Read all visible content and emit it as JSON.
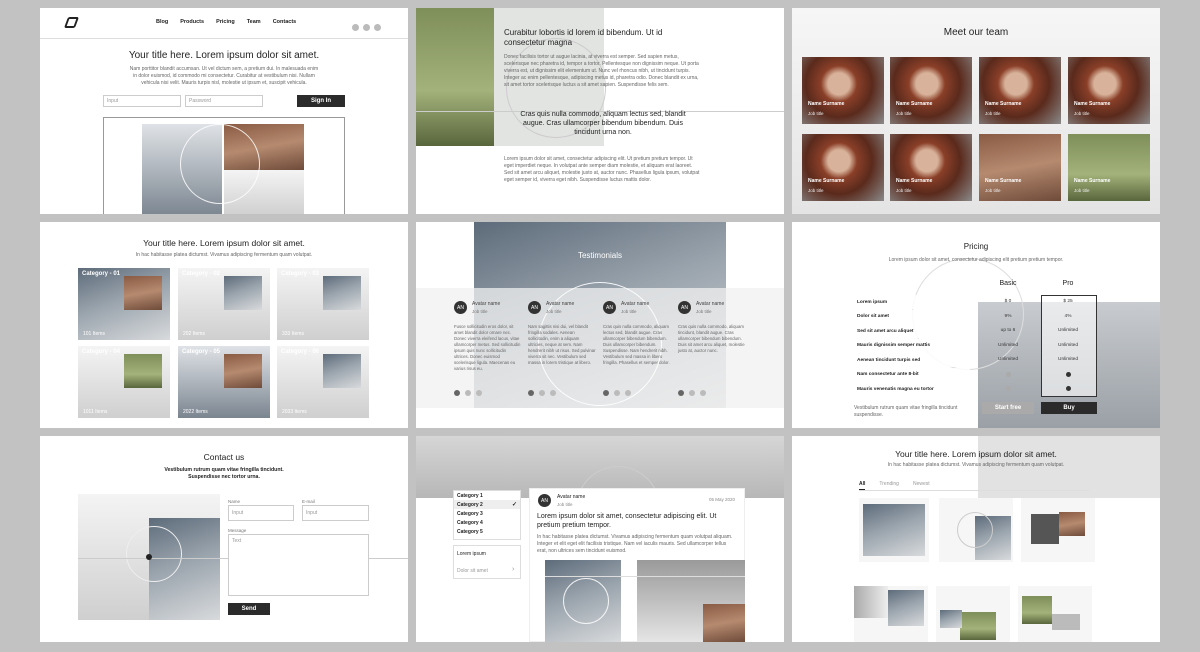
{
  "f1": {
    "nav": [
      "Blog",
      "Products",
      "Pricing",
      "Team",
      "Contacts"
    ],
    "title": "Your title here. Lorem ipsum dolor sit amet.",
    "body": "Nam porttitor blandit accumsan. Ut vel dictum sem, a pretium dui. In malesuada enim in dolor euismod, id commodo mi consectetur. Curabitur at vestibulum nisi. Nullam vehicula nisi velit. Mauris turpis nisl, molestie ut ipsum et, suscipit vehicula.",
    "input_placeholder": "Input",
    "password_placeholder": "Password",
    "signin": "Sign In"
  },
  "f2": {
    "heading": "Curabitur lobortis id lorem id bibendum. Ut id consectetur magna",
    "para1": "Donec facilisis tortor ut augue lacinia, at viverra est semper. Sed sapien metus, scelerisque nec pharetra id, tempor a tortor. Pellentesque non dignissim neque. Ut porta viverra est, ut dignissim elit elementum ut. Nunc vel rhoncus nibh, ut tincidunt turpis. Integer ac enim pellentesque, adipiscing metus id, pharetra odio. Donec blandit ex urna, sit amet tortor scelerisque luctus a sit amet sapien. Suspendisse felis sem.",
    "quote": "Cras quis nulla commodo, aliquam lectus sed, blandit augue. Cras ullamcorper bibendum bibendum. Duis tincidunt urna non.",
    "para2": "Lorem ipsum dolor sit amet, consectetur adipiscing elit. Ut pretium pretium tempor. Ut eget imperdiet neque. In volutpat ante semper diam molestie, et aliquam erat laoreet. Sed sit amet arcu aliquet, molestie justo at, auctor nunc. Phasellus ligula ipsum, volutpat eget semper id, viverra eget nibh. Suspendisse luctus mattis dolor."
  },
  "f3": {
    "title": "Meet our team",
    "member_name": "Name Surname",
    "member_job": "Job title"
  },
  "f4": {
    "title": "Your title here. Lorem ipsum dolor sit amet.",
    "subtitle": "In hac habitasse platea dictumst. Vivamus adipiscing fermentum quam volutpat.",
    "categories": [
      {
        "label": "Category - 01",
        "count": "101 Items"
      },
      {
        "label": "Category - 02",
        "count": "202 Items"
      },
      {
        "label": "Category - 03",
        "count": "333 Items"
      },
      {
        "label": "Category - 04",
        "count": "1011 Items"
      },
      {
        "label": "Category - 05",
        "count": "2022 Items"
      },
      {
        "label": "Category - 06",
        "count": "2033 Items"
      }
    ]
  },
  "f5": {
    "title": "Testimonials",
    "initials": "AN",
    "name": "Avatar name",
    "job": "Job title",
    "quotes": [
      "Fusce sollicitudin eros dolor, sit amet blandit dolor ornare nec. Donec viverra eleifend lacus, vitae ullamcorper metus. Sed sollicitudin ipsum quis nunc sollicitudin ultrices. Donec euismod scelerisque ligula. Maecenas eu varius risus eu.",
      "Nam sagittis nisi dui, vel blandit fringilla sodales. Aenean sollicitudin, enim a aliquam ultricies, neque at sem. Nam hendrerit nibh ut risus. Sed pulvinar viverra sit nec. Vestibulum sed massa in lorem tristique at libero.",
      "Cras quis nulla commodo, aliquam lectus sed, blandit augue. Cras ullamcorper bibendum bibendum. Duis ullamcorper bibendum. Suspendisse. Nam hendrerit nibh. Vestibulum sed massa in libero fringilla. Phasellus et semper dolor.",
      "Cras quis nulla commodo, aliquam tincidunt, blandit augue. Cras ullamcorper bibendum bibendum. Duis sit amet arcu aliquet, molestie justo at, auctor nunc."
    ]
  },
  "f6": {
    "title": "Pricing",
    "subtitle": "Lorem ipsum dolor sit amet, consectetur adipiscing elit pretium pretium tempor.",
    "plan_basic": "Basic",
    "plan_pro": "Pro",
    "features": [
      {
        "name": "Lorem ipsum",
        "basic": "$ 0",
        "pro": "$ 25"
      },
      {
        "name": "Dolor sit amet",
        "basic": "9%",
        "pro": "4%"
      },
      {
        "name": "Sed sit amet arcu aliquet",
        "basic": "up to 6",
        "pro": "Unlimited"
      },
      {
        "name": "Mauris dignissim semper mattis",
        "basic": "Unlimited",
        "pro": "Unlimited"
      },
      {
        "name": "Aenean tincidunt turpis sed",
        "basic": "Unlimited",
        "pro": "Unlimited"
      },
      {
        "name": "Nam consectetur ante 8-bit",
        "basic": "",
        "pro": ""
      },
      {
        "name": "Mauris venenatis magna eu tortor",
        "basic": "",
        "pro": ""
      }
    ],
    "footnote": "Vestibulum rutrum quam vitae fringilla tincidunt suspendisse.",
    "start_free": "Start free",
    "buy": "Buy"
  },
  "f7": {
    "title": "Contact us",
    "subtitle": "Vestibulum rutrum quam vitae fringilla tincidunt. Suspendisse nec tortor urna.",
    "name_label": "Name",
    "name_placeholder": "Input",
    "email_label": "E-mail",
    "email_placeholder": "Input",
    "message_label": "Message",
    "message_placeholder": "Text",
    "send": "Send"
  },
  "f8": {
    "categories": [
      "Category 1",
      "Category 2",
      "Category 3",
      "Category 4",
      "Category 5"
    ],
    "selected": "Category 2",
    "lorem_item": "Lorem ipsum",
    "dolor_item": "Dolor sit amet",
    "initials": "AN",
    "author": "Avatar name",
    "job": "Job title",
    "date": "05 May 2020",
    "title": "Lorem ipsum dolor sit amet, consectetur adipiscing elit. Ut pretium pretium tempor.",
    "body": "In hac habitasse platea dictumst. Vivamus adipiscing fermentum quam volutpat aliquam. Integer et elit eget elit facilisis tristique. Nam vel iaculis mauris. Sed ullamcorper tellus erat, non ultrices sem tincidunt euismod."
  },
  "f9": {
    "title": "Your title here. Lorem ipsum dolor sit amet.",
    "subtitle": "In hac habitasse platea dictumst. Vivamus adipiscing fermentum quam volutpat.",
    "tabs": [
      "All",
      "Trending",
      "Newest"
    ]
  }
}
